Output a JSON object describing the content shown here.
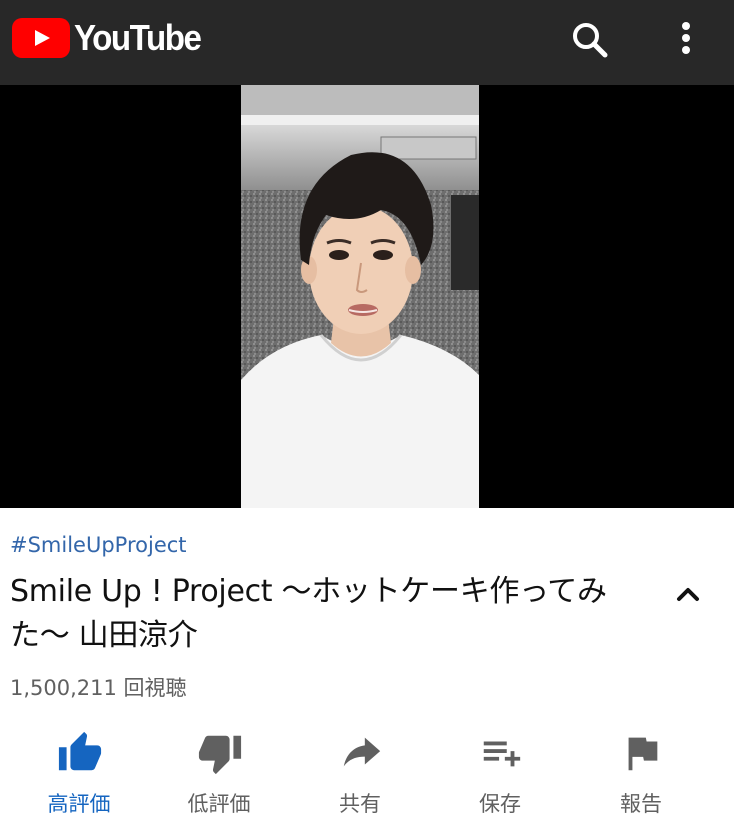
{
  "header": {
    "logo_text": "YouTube",
    "brand_color": "#ff0000",
    "bar_color": "#282828",
    "icons": [
      "youtube-play-icon",
      "search-icon",
      "more-vert-icon"
    ]
  },
  "video": {
    "hashtag": "#SmileUpProject",
    "title": "Smile Up ! Project 〜ホットケーキ作ってみた〜 山田涼介",
    "views": "1,500,211 回視聴"
  },
  "actions": [
    {
      "label": "高評価",
      "icon": "thumb-up-icon",
      "active": true
    },
    {
      "label": "低評価",
      "icon": "thumb-down-icon",
      "active": false
    },
    {
      "label": "共有",
      "icon": "share-icon",
      "active": false
    },
    {
      "label": "保存",
      "icon": "playlist-add-icon",
      "active": false
    },
    {
      "label": "報告",
      "icon": "flag-icon",
      "active": false
    }
  ],
  "colors": {
    "accent": "#1565c0",
    "link": "#3366aa",
    "secondary_text": "#606060"
  }
}
